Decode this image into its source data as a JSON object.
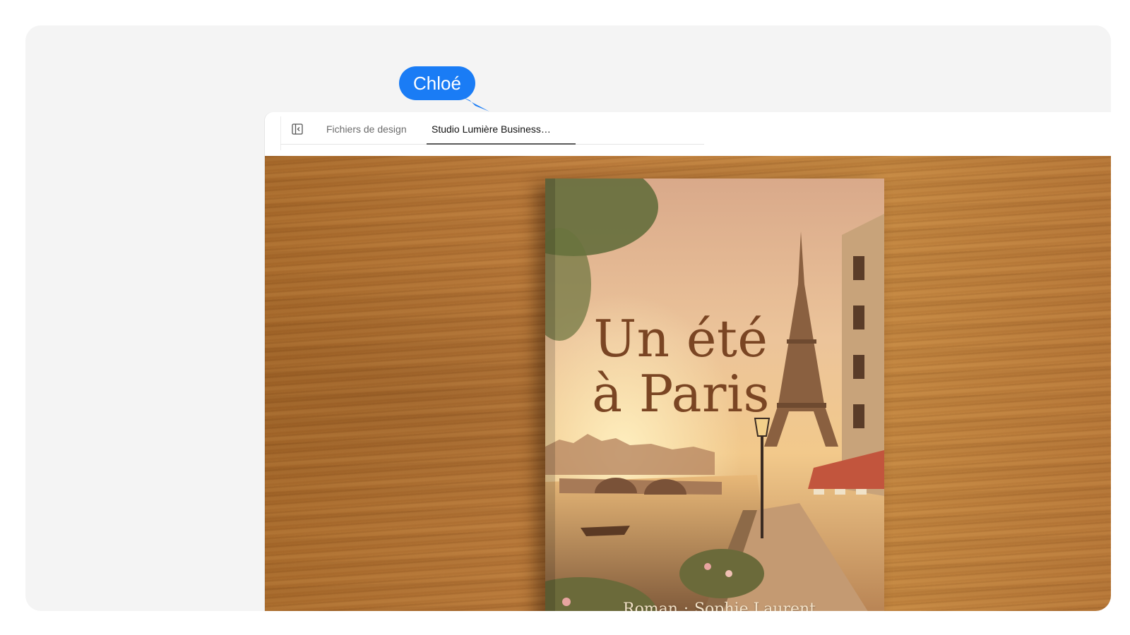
{
  "tabs": {
    "files_label": "Fichiers de design",
    "active_label": "Studio Lumière Business…"
  },
  "book": {
    "title_line1": "Un été",
    "title_line2": "à Paris",
    "genre": "Roman",
    "separator": "·",
    "author": "Sophie Laurent"
  },
  "collaborator": {
    "name": "Chloé",
    "color": "#1a7cf5"
  },
  "icons": {
    "sidebar_toggle": "sidebar-toggle-icon"
  }
}
